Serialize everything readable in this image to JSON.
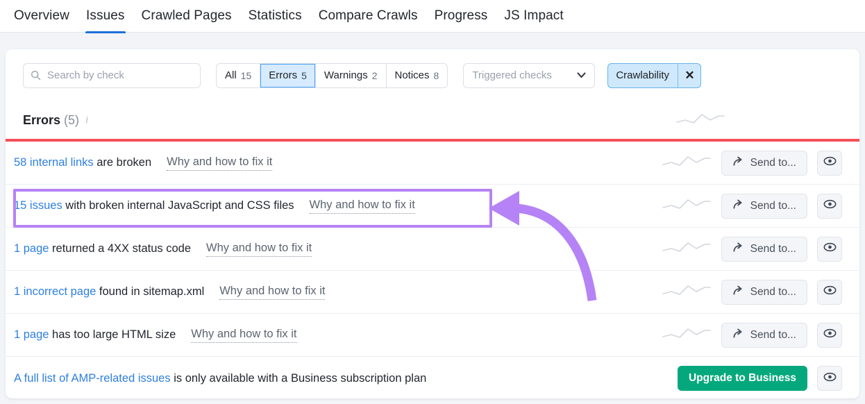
{
  "nav": {
    "tabs": [
      {
        "label": "Overview",
        "active": false
      },
      {
        "label": "Issues",
        "active": true
      },
      {
        "label": "Crawled Pages",
        "active": false
      },
      {
        "label": "Statistics",
        "active": false
      },
      {
        "label": "Compare Crawls",
        "active": false
      },
      {
        "label": "Progress",
        "active": false
      },
      {
        "label": "JS Impact",
        "active": false
      }
    ]
  },
  "filters": {
    "search": {
      "placeholder": "Search by check",
      "value": ""
    },
    "segments": [
      {
        "label": "All",
        "count": "15",
        "selected": false
      },
      {
        "label": "Errors",
        "count": "5",
        "selected": true
      },
      {
        "label": "Warnings",
        "count": "2",
        "selected": false
      },
      {
        "label": "Notices",
        "count": "8",
        "selected": false
      }
    ],
    "dropdown": {
      "label": "Triggered checks"
    },
    "chip": {
      "label": "Crawlability",
      "remove": "✕"
    }
  },
  "section": {
    "title": "Errors",
    "count": "(5)",
    "info": "i"
  },
  "rows": [
    {
      "link": "58 internal links",
      "rest": " are broken",
      "fix": "Why and how to fix it",
      "action": "Send to...",
      "action_type": "send",
      "highlighted": false
    },
    {
      "link": "15 issues",
      "rest": " with broken internal JavaScript and CSS files",
      "fix": "Why and how to fix it",
      "action": "Send to...",
      "action_type": "send",
      "highlighted": true
    },
    {
      "link": "1 page",
      "rest": " returned a 4XX status code",
      "fix": "Why and how to fix it",
      "action": "Send to...",
      "action_type": "send",
      "highlighted": false
    },
    {
      "link": "1 incorrect page",
      "rest": " found in sitemap.xml",
      "fix": "Why and how to fix it",
      "action": "Send to...",
      "action_type": "send",
      "highlighted": false
    },
    {
      "link": "1 page",
      "rest": " has too large HTML size",
      "fix": "Why and how to fix it",
      "action": "Send to...",
      "action_type": "send",
      "highlighted": false
    },
    {
      "link": "A full list of AMP-related issues",
      "rest": " is only available with a Business subscription plan",
      "fix": "",
      "action": "Upgrade to Business",
      "action_type": "upgrade",
      "highlighted": false
    }
  ],
  "colors": {
    "accent_blue": "#2e7fe0",
    "tab_underline": "#1e6fd9",
    "error_red": "#f4505a",
    "chip_blue": "#cfe8fb",
    "upgrade_green": "#05a87c",
    "annotation_purple": "#b583f5"
  },
  "annotation": {
    "shape": "curved-arrow-pointing-left",
    "color": "#b583f5",
    "target_row_index": 1
  }
}
